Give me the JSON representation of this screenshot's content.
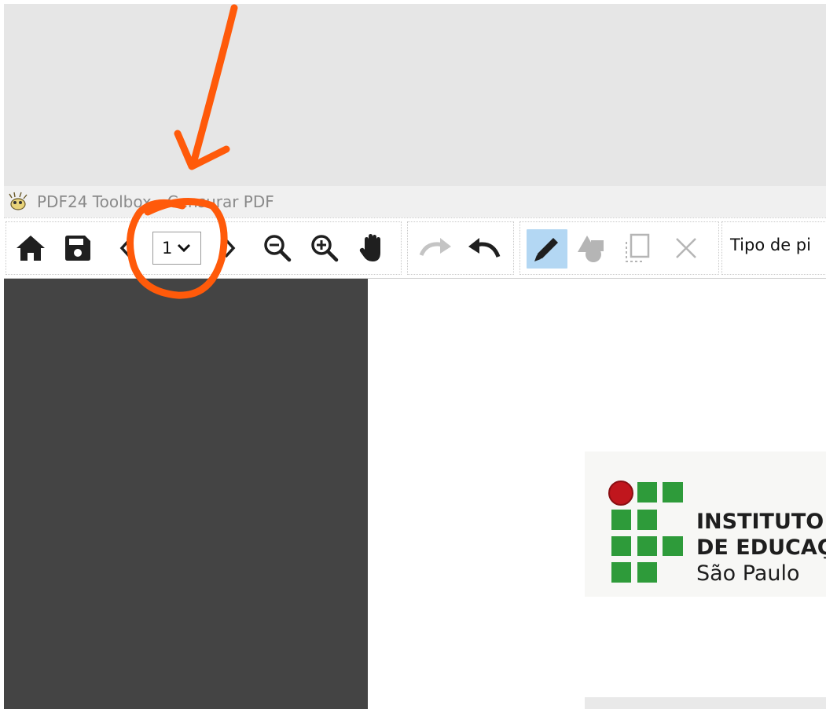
{
  "window": {
    "title": "PDF24 Toolbox - Censurar PDF"
  },
  "toolbar": {
    "home_icon": "home-icon",
    "save_icon": "save-icon",
    "prev_icon": "chevron-left-icon",
    "page_number": "1",
    "next_icon": "chevron-right-icon",
    "zoom_out_icon": "zoom-out-icon",
    "zoom_in_icon": "zoom-in-icon",
    "hand_icon": "hand-icon",
    "redo_icon": "redo-icon",
    "undo_icon": "undo-icon",
    "pen_icon": "pen-icon",
    "shapes_icon": "shapes-icon",
    "selection_icon": "selection-icon",
    "close_icon": "close-icon",
    "tipo_label": "Tipo de pi"
  },
  "document": {
    "logo_line1": "INSTITUTO",
    "logo_line2": "DE EDUCAÇ",
    "logo_line3": "São Paulo"
  },
  "colors": {
    "annotation": "#ff5a0a",
    "sidebar": "#444444",
    "pen_active": "#b3d7f3",
    "logo_green": "#2e9b3a",
    "logo_red": "#c0161d"
  }
}
